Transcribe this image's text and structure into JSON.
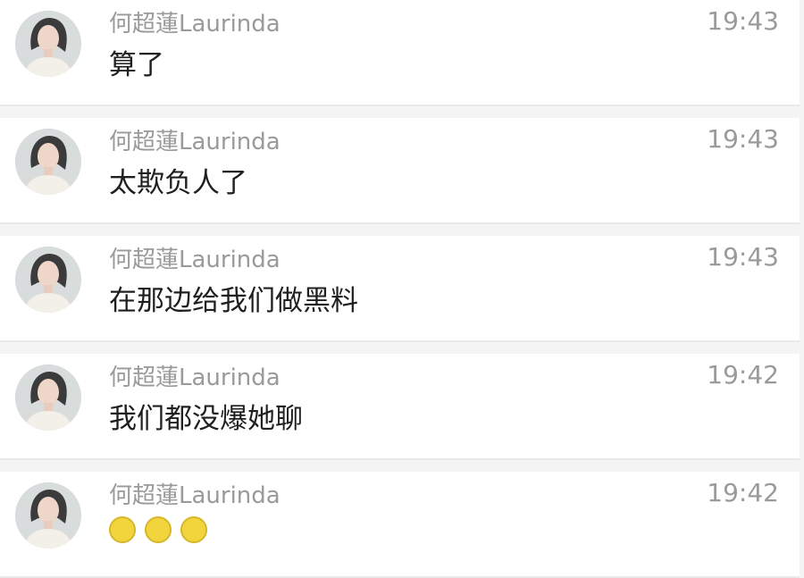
{
  "messages": [
    {
      "sender": "何超蓮Laurinda",
      "time": "19:43",
      "text": "算了"
    },
    {
      "sender": "何超蓮Laurinda",
      "time": "19:43",
      "text": "太欺负人了"
    },
    {
      "sender": "何超蓮Laurinda",
      "time": "19:43",
      "text": "在那边给我们做黑料"
    },
    {
      "sender": "何超蓮Laurinda",
      "time": "19:42",
      "text": "我们都没爆她聊"
    },
    {
      "sender": "何超蓮Laurinda",
      "time": "19:42",
      "emoji": [
        "emoji-icon",
        "emoji-icon",
        "emoji-icon"
      ]
    }
  ],
  "colors": {
    "background": "#f4f4f4",
    "row_background": "#ffffff",
    "meta_text": "#9a9a9a",
    "message_text": "#1f1f1f"
  }
}
